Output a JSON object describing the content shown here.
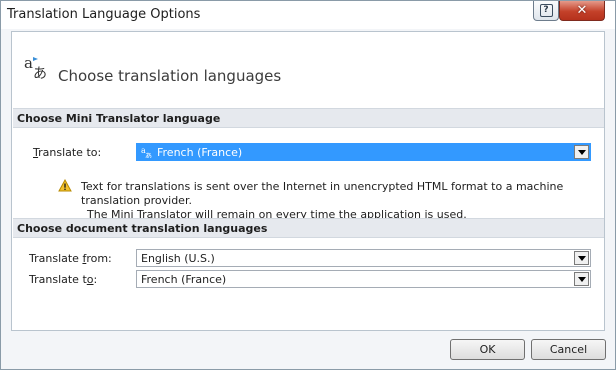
{
  "window": {
    "title": "Translation Language Options",
    "help_glyph": "?",
    "close_glyph": "✕"
  },
  "header": {
    "text": "Choose translation languages",
    "icon": "translate-icon"
  },
  "mini_translator": {
    "section_title": "Choose Mini Translator language",
    "translate_to_label_accel": "T",
    "translate_to_label_rest": "ranslate to:",
    "translate_to_value": "French (France)",
    "value_icon": "translate-icon",
    "warning": {
      "icon": "warning-icon",
      "line1": "Text for translations is sent over the Internet in unencrypted HTML format to a machine translation provider.",
      "line2": "The Mini Translator will remain on every time the application is used."
    }
  },
  "document_translation": {
    "section_title": "Choose document translation languages",
    "from_label_pre": "Translate ",
    "from_label_accel": "f",
    "from_label_post": "rom:",
    "from_value": "English (U.S.)",
    "to_label_pre": "Translate t",
    "to_label_accel": "o",
    "to_label_post": ":",
    "to_value": "French (France)"
  },
  "buttons": {
    "ok": "OK",
    "cancel": "Cancel"
  },
  "colors": {
    "selection": "#3399ff",
    "close": "#c4412a",
    "warning": "#f2c12e"
  }
}
